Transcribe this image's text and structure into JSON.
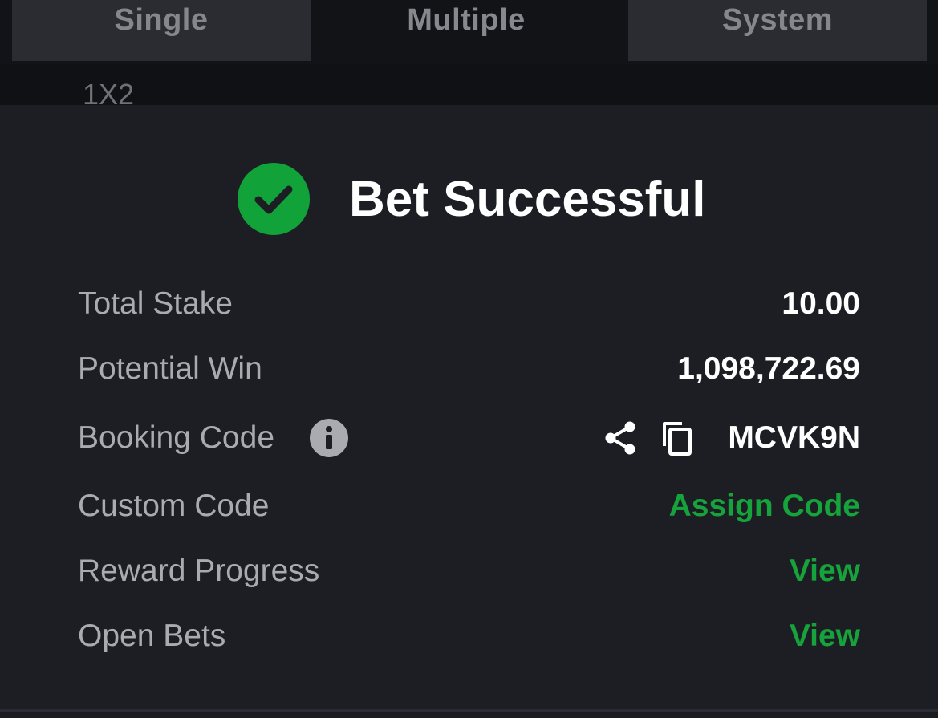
{
  "tabs": {
    "single": "Single",
    "multiple": "Multiple",
    "system": "System"
  },
  "market_label": "1X2",
  "success": {
    "title": "Bet Successful"
  },
  "details": {
    "total_stake_label": "Total Stake",
    "total_stake_value": "10.00",
    "potential_win_label": "Potential Win",
    "potential_win_value": "1,098,722.69",
    "booking_code_label": "Booking Code",
    "booking_code_value": "MCVK9N",
    "custom_code_label": "Custom Code",
    "custom_code_action": "Assign Code",
    "reward_progress_label": "Reward Progress",
    "reward_progress_action": "View",
    "open_bets_label": "Open Bets",
    "open_bets_action": "View"
  },
  "colors": {
    "accent_green": "#16a33b",
    "panel_bg": "#1d1e24",
    "label_gray": "#a9abb1"
  },
  "icons": [
    "check-circle-icon",
    "info-icon",
    "share-icon",
    "copy-icon"
  ]
}
